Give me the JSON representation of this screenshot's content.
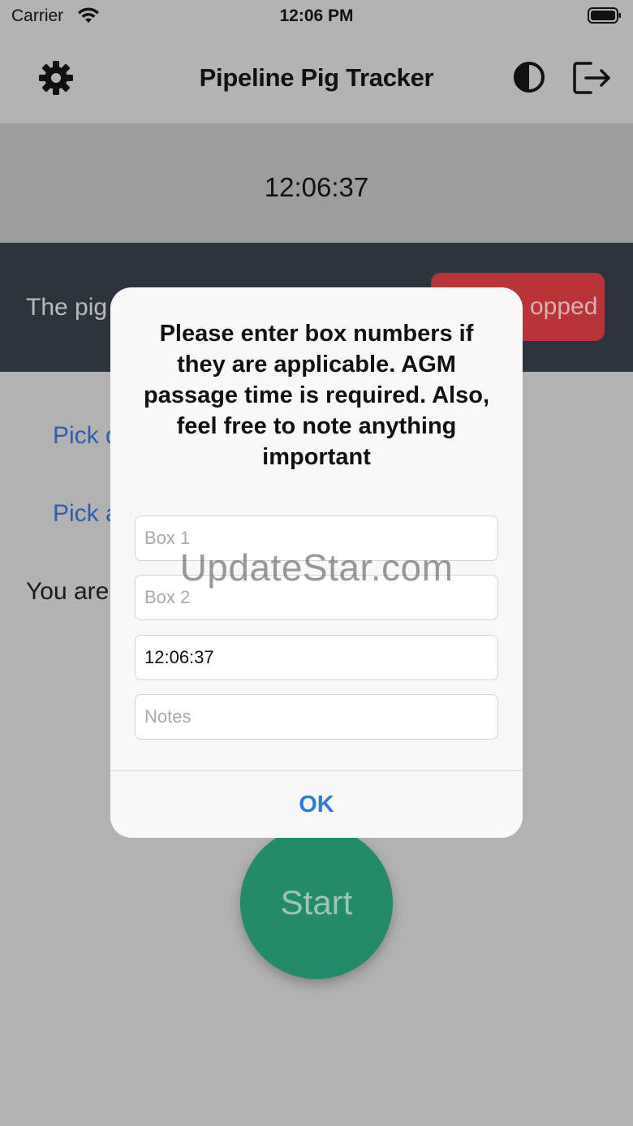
{
  "status_bar": {
    "carrier": "Carrier",
    "time": "12:06 PM",
    "icons": [
      "wifi-icon",
      "battery-icon"
    ]
  },
  "nav": {
    "title": "Pipeline Pig Tracker",
    "icons": [
      "gear-icon",
      "contrast-icon",
      "logout-icon"
    ]
  },
  "timer": {
    "display": "12:06:37"
  },
  "banner": {
    "text": "The pig",
    "button_label": "opped",
    "button_color": "#b83437"
  },
  "content": {
    "pick_first": "Pick d",
    "pick_second": "Pick a",
    "you_are": "You are",
    "start_label": "Start",
    "start_color": "#238a6c"
  },
  "dialog": {
    "message": "Please enter box numbers if they are applicable. AGM passage time is required. Also, feel free to note anything important",
    "box1": {
      "value": "",
      "placeholder": "Box 1"
    },
    "box2": {
      "value": "",
      "placeholder": "Box 2"
    },
    "time_value": "12:06:37",
    "notes": {
      "value": "",
      "placeholder": "Notes"
    },
    "ok_label": "OK",
    "accent": "#2f7bd9"
  },
  "watermark": "UpdateStar.com"
}
